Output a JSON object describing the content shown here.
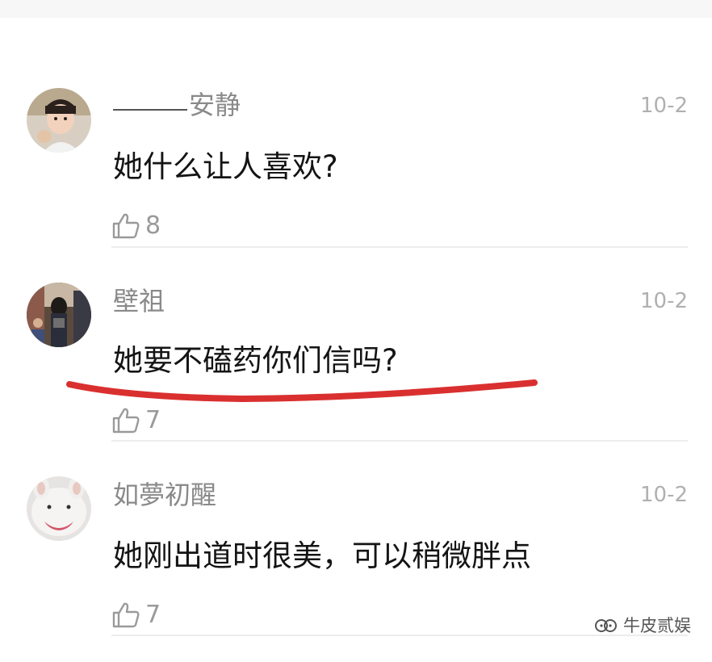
{
  "comments": [
    {
      "username": "安静",
      "timestamp": "10-2",
      "text": "她什么让人喜欢?",
      "likes": "8"
    },
    {
      "username": "壁祖",
      "timestamp": "10-2",
      "text": "她要不磕药你们信吗?",
      "likes": "7"
    },
    {
      "username": "如夢初醒",
      "timestamp": "10-2",
      "text": "她刚出道时很美，可以稍微胖点",
      "likes": "7"
    }
  ],
  "watermark": {
    "text": "牛皮贰娱",
    "icon": "wechat-official-account-icon"
  },
  "colors": {
    "underline": "#d9302f",
    "username": "#8a8a8a",
    "timestamp": "#b0b0b0",
    "text": "#141414"
  }
}
